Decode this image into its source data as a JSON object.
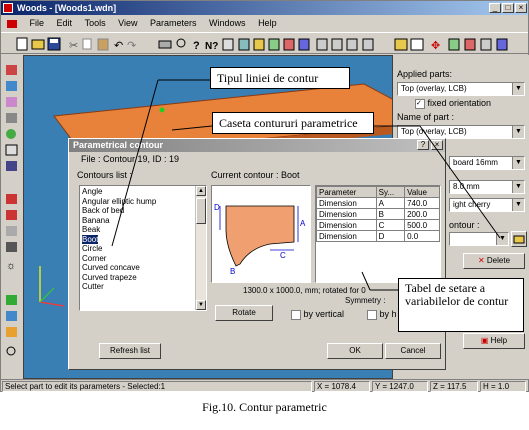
{
  "window": {
    "title": "Woods - [Woods1.wdn]"
  },
  "menu": [
    "File",
    "Edit",
    "Tools",
    "View",
    "Parameters",
    "Windows",
    "Help"
  ],
  "right_panel": {
    "applied_parts_label": "Applied parts:",
    "applied_parts_value": "Top (overlay, LCB)",
    "fixed_orientation": "fixed orientation",
    "name_of_part_label": "Name of part :",
    "name_of_part_value": "Top (overlay, LCB)",
    "board_value": "board 16mm",
    "thickness_value": "8.0 mm",
    "material_value": "ight cherry",
    "contour_label": "ontour :",
    "delete_label": "Delete",
    "help_label": "Help"
  },
  "status": {
    "message": "Select part to edit its parameters - Selected:1",
    "x": "X = 1078.4",
    "y": "Y = 1247.0",
    "z": "Z = 117.5",
    "h": "H = 1.0"
  },
  "dialog": {
    "title": "Parametrical contour",
    "file_info": "File : Contour 19, ID : 19",
    "contours_list_label": "Contours list :",
    "contours": [
      "Angle",
      "Angular elliptic hump",
      "Back of bed",
      "Banana",
      "Beak",
      "Boot",
      "Circle",
      "Corner",
      "Curved concave",
      "Curved trapeze",
      "Cutter"
    ],
    "selected_contour": "Boot",
    "current_contour_label": "Current contour : Boot",
    "table_headers": [
      "Parameter",
      "Sy...",
      "Value"
    ],
    "table_rows": [
      [
        "Dimension",
        "A",
        "740.0"
      ],
      [
        "Dimension",
        "B",
        "200.0"
      ],
      [
        "Dimension",
        "C",
        "500.0"
      ],
      [
        "Dimension",
        "D",
        "0.0"
      ]
    ],
    "size_text": "1300.0 x 1000.0, mm; rotated for 0",
    "symmetry_label": "Symmetry :",
    "rotate_label": "Rotate",
    "by_vertical_label": "by vertical",
    "by_horizontal_label": "by h",
    "refresh_label": "Refresh list",
    "ok_label": "OK",
    "cancel_label": "Cancel",
    "preview_letters": {
      "a": "A",
      "b": "B",
      "c": "C",
      "d": "D"
    }
  },
  "callouts": {
    "line_type": "Tipul liniei de contur",
    "contours_box": "Caseta contururi parametrice",
    "table": "Tabel de setare a variabilelor de contur"
  },
  "caption": "Fig.10. Contur parametric",
  "colors": {
    "board": "#e8823a",
    "viewport": "#3a7fb3",
    "selection": "#0a246a"
  }
}
